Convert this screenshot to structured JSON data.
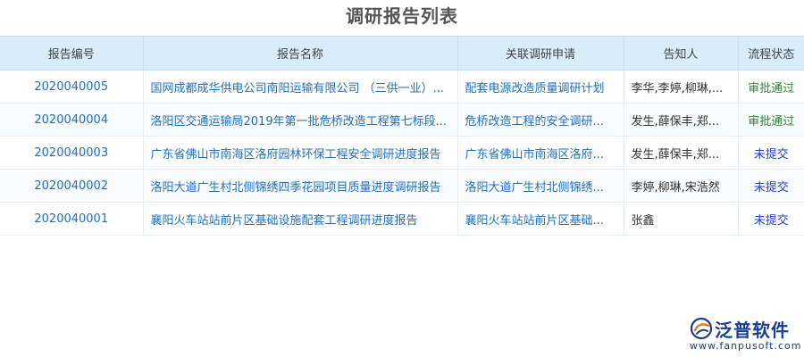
{
  "page": {
    "title": "调研报告列表"
  },
  "table": {
    "headers": {
      "report_no": "报告编号",
      "report_name": "报告名称",
      "related_apply": "关联调研申请",
      "notify": "告知人",
      "status": "流程状态"
    },
    "rows": [
      {
        "report_no": "2020040005",
        "report_name": "国网成都成华供电公司南阳运输有限公司 （三供一业）...",
        "related_apply": "配套电源改造质量调研计划",
        "notify": "李华,李婷,柳琳,...",
        "status": "审批通过",
        "status_color": "#2e8b2e"
      },
      {
        "report_no": "2020040004",
        "report_name": "洛阳区交通运输局2019年第一批危桥改造工程第七标段...",
        "related_apply": "危桥改造工程的安全调研...",
        "notify": "发生,薛保丰,郑...",
        "status": "审批通过",
        "status_color": "#2e8b2e"
      },
      {
        "report_no": "2020040003",
        "report_name": "广东省佛山市南海区洛府园林环保工程安全调研进度报告",
        "related_apply": "广东省佛山市南海区洛府...",
        "notify": "发生,薛保丰,郑...",
        "status": "未提交",
        "status_color": "#1f3fd0"
      },
      {
        "report_no": "2020040002",
        "report_name": "洛阳大道广生村北侧锦绣四季花园项目质量进度调研报告",
        "related_apply": "洛阳大道广生村北侧锦绣...",
        "notify": "李婷,柳琳,宋浩然",
        "status": "未提交",
        "status_color": "#1f3fd0"
      },
      {
        "report_no": "2020040001",
        "report_name": "襄阳火车站站前片区基础设施配套工程调研进度报告",
        "related_apply": "襄阳火车站站前片区基础...",
        "notify": "张鑫",
        "status": "未提交",
        "status_color": "#1f3fd0"
      }
    ]
  },
  "watermark": {
    "brand": "泛普软件",
    "url": "www.fanpusoft.com",
    "icon": "fanpu-logo-icon"
  }
}
